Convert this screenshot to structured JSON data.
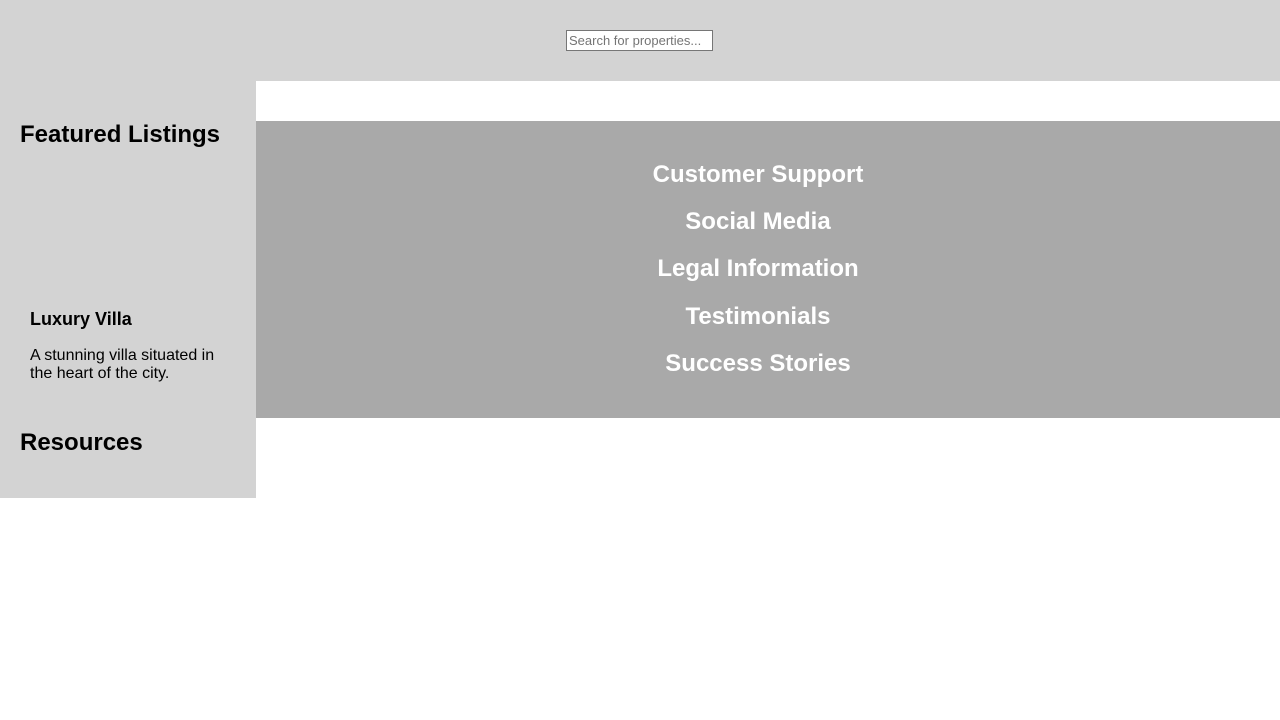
{
  "header": {
    "search": {
      "placeholder": "Search for properties...",
      "value": ""
    }
  },
  "sidebar": {
    "featured_heading": "Featured Listings",
    "listing": {
      "title": "Luxury Villa",
      "description": "A stunning villa situated in the heart of the city."
    },
    "resources_heading": "Resources"
  },
  "footer": {
    "sections": [
      "Customer Support",
      "Social Media",
      "Legal Information",
      "Testimonials",
      "Success Stories"
    ]
  },
  "colors": {
    "header_bg": "#d3d3d3",
    "sidebar_bg": "#d3d3d3",
    "footer_bg": "#a9a9a9",
    "footer_text": "#ffffff"
  }
}
